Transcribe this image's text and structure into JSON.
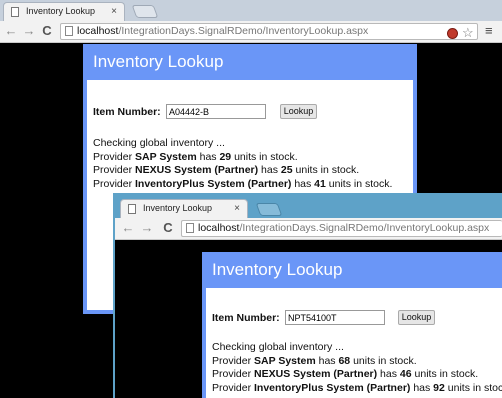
{
  "windows": [
    {
      "tab_title": "Inventory Lookup",
      "tab_close": "×",
      "url_host": "localhost",
      "url_path": "/IntegrationDays.SignalRDemo/InventoryLookup.aspx",
      "page_title": "Inventory Lookup",
      "item_label": "Item Number:",
      "item_value": "A04442-B",
      "lookup_label": "Lookup",
      "checking_text": "Checking global inventory ...",
      "providers": [
        {
          "prefix": "Provider ",
          "name": "SAP System",
          "mid": " has ",
          "units": "29",
          "suffix": " units in stock."
        },
        {
          "prefix": "Provider ",
          "name": "NEXUS System (Partner)",
          "mid": " has ",
          "units": "25",
          "suffix": " units in stock."
        },
        {
          "prefix": "Provider ",
          "name": "InventoryPlus System (Partner)",
          "mid": " has ",
          "units": "41",
          "suffix": " units in stock."
        }
      ]
    },
    {
      "tab_title": "Inventory Lookup",
      "tab_close": "×",
      "url_host": "localhost",
      "url_path": "/IntegrationDays.SignalRDemo/InventoryLookup.aspx",
      "page_title": "Inventory Lookup",
      "item_label": "Item Number:",
      "item_value": "NPT54100T",
      "lookup_label": "Lookup",
      "checking_text": "Checking global inventory ...",
      "providers": [
        {
          "prefix": "Provider ",
          "name": "SAP System",
          "mid": " has ",
          "units": "68",
          "suffix": " units in stock."
        },
        {
          "prefix": "Provider ",
          "name": "NEXUS System (Partner)",
          "mid": " has ",
          "units": "46",
          "suffix": " units in stock."
        },
        {
          "prefix": "Provider ",
          "name": "InventoryPlus System (Partner)",
          "mid": " has ",
          "units": "92",
          "suffix": " units in stock."
        }
      ]
    }
  ],
  "nav": {
    "back": "←",
    "forward": "→",
    "reload": "C",
    "star": "☆",
    "menu": "≡"
  }
}
